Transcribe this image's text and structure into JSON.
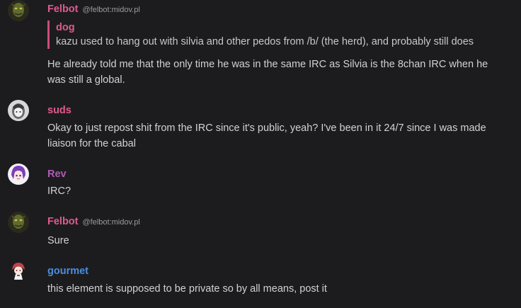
{
  "colors": {
    "background": "#1c1c1f",
    "text": "#d2d2d6",
    "muted": "#9a9aa2",
    "quote_bar": "#d04a7a"
  },
  "messages": [
    {
      "sender": "Felbot",
      "user_id": "@felbot:midov.pl",
      "sender_color": "#e05a8e",
      "avatar": "green-goblin-avatar",
      "quote": {
        "sender": "dog",
        "text": "kazu used to hang out with silvia and other pedos from /b/ (the herd), and probably still does"
      },
      "body": "He already told me that the only time he was in the same IRC as Silvia is the 8chan IRC when he was still a global."
    },
    {
      "sender": "suds",
      "sender_color": "#e05a8e",
      "avatar": "grey-character-avatar",
      "body": "Okay to just repost shit from the IRC since it's public, yeah? I've been in it 24/7 since I was made liaison for the cabal"
    },
    {
      "sender": "Rev",
      "sender_color": "#b05ab6",
      "avatar": "purple-hair-avatar",
      "body": "IRC?"
    },
    {
      "sender": "Felbot",
      "user_id": "@felbot:midov.pl",
      "sender_color": "#e05a8e",
      "avatar": "green-goblin-avatar",
      "body": "Sure"
    },
    {
      "sender": "gourmet",
      "sender_color": "#4a8ee0",
      "avatar": "red-hair-chibi-avatar",
      "body": "this element is supposed to be private so by all means, post it"
    }
  ]
}
